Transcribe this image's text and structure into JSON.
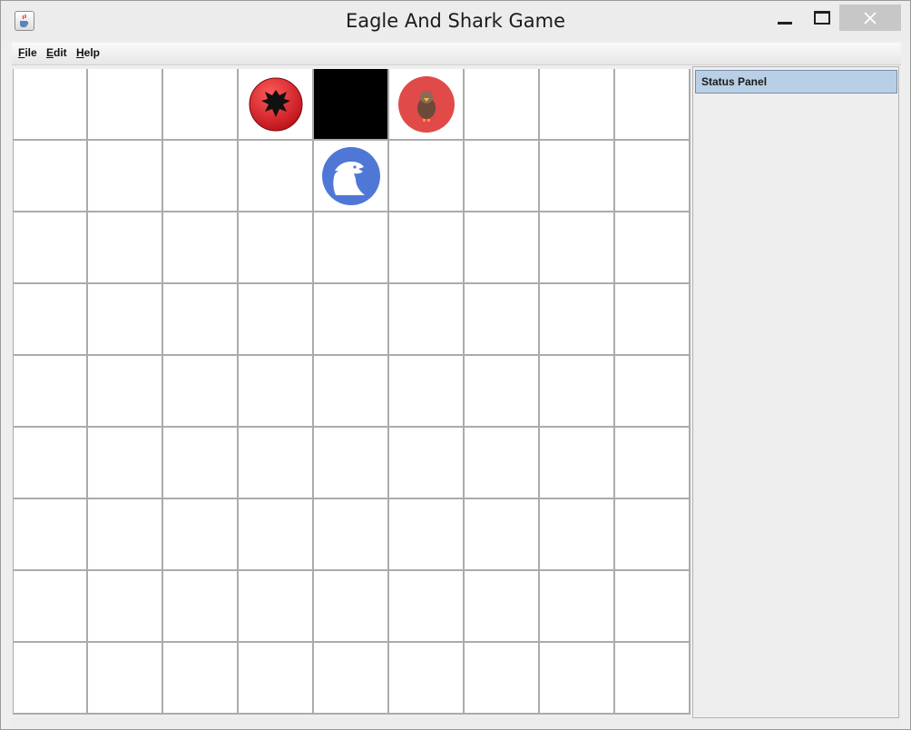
{
  "window": {
    "title": "Eagle And Shark Game",
    "app_icon": "java-coffee-cup-icon",
    "controls": [
      "minimize-icon",
      "maximize-icon",
      "close-icon"
    ]
  },
  "menu": {
    "items": [
      "File",
      "Edit",
      "Help"
    ]
  },
  "board": {
    "rows": 9,
    "cols": 9,
    "black_cells": [
      [
        0,
        4
      ]
    ],
    "pieces": [
      {
        "row": 0,
        "col": 3,
        "icon": "albanian-flag-eagle-icon",
        "color": "#c0141c"
      },
      {
        "row": 0,
        "col": 5,
        "icon": "brown-eagle-icon",
        "color": "#e04a48"
      },
      {
        "row": 1,
        "col": 4,
        "icon": "bald-eagle-icon",
        "color": "#4f78d6"
      }
    ]
  },
  "status_panel": {
    "title": "Status Panel",
    "header_color": "#b8cfe5"
  }
}
